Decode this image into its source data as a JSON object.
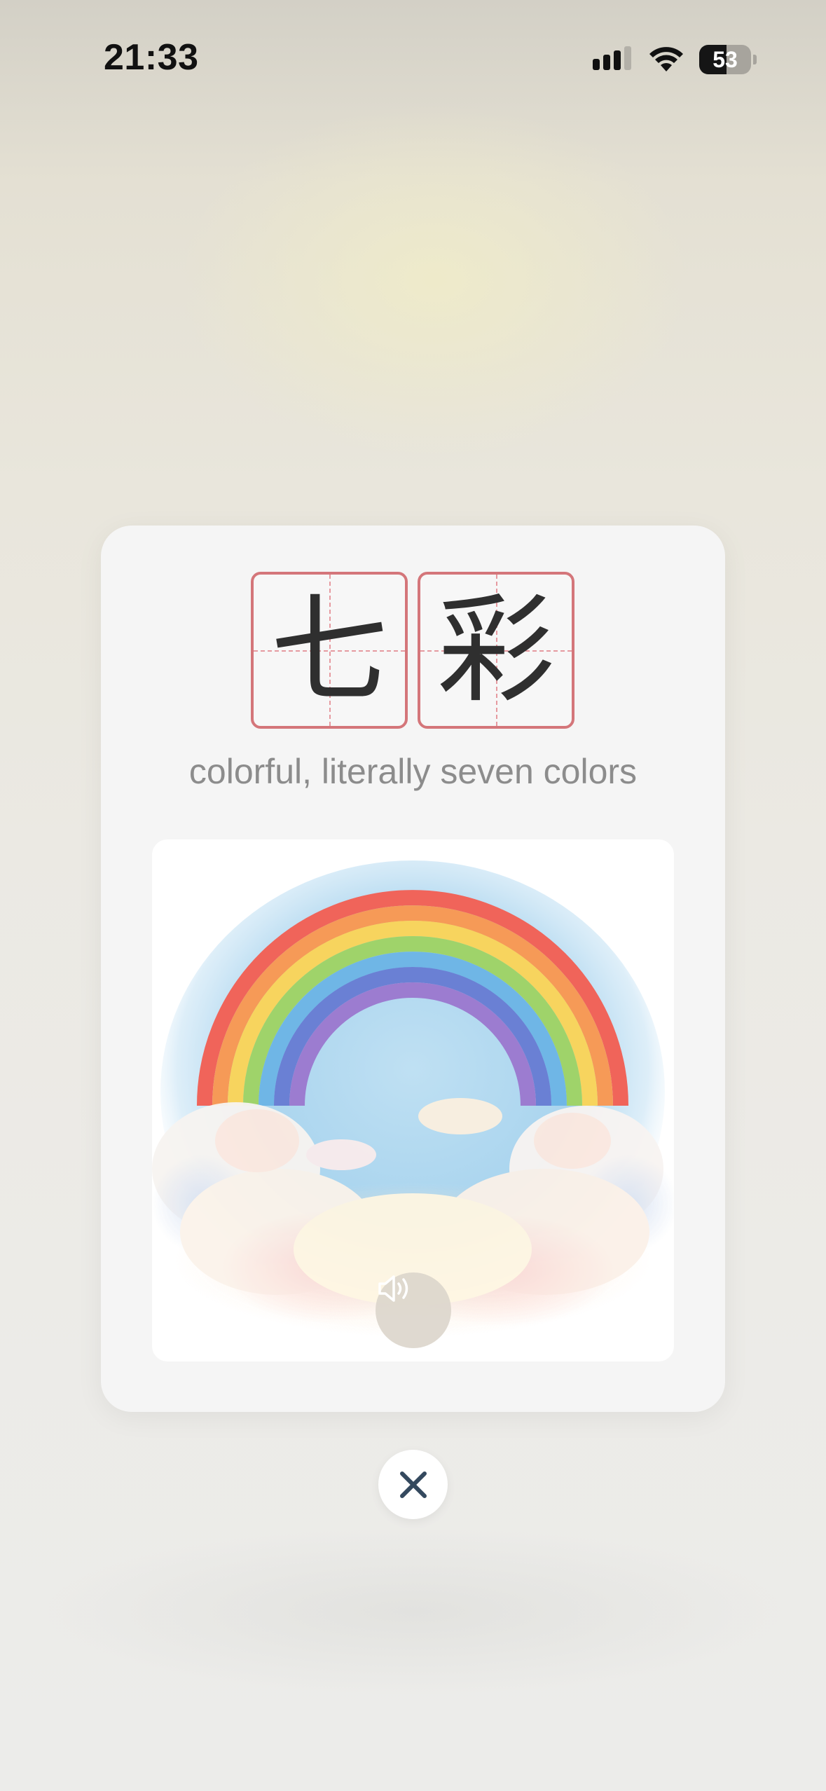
{
  "status_bar": {
    "time": "21:33",
    "battery_percent": "53",
    "battery_level": 0.53,
    "icons": [
      "cellular-signal-icon",
      "wifi-icon",
      "battery-icon"
    ]
  },
  "flashcard": {
    "characters": [
      "七",
      "彩"
    ],
    "meaning": "colorful, literally seven colors",
    "illustration": "rainbow-over-clouds",
    "audio_button_icon": "speaker-icon",
    "grid_color": "#d4767a"
  },
  "close_button": {
    "icon": "close-icon"
  },
  "colors": {
    "character": "#2f2f2f",
    "meaning_text": "#8c8c8c",
    "close_icon": "#34495e",
    "card_background": "#f5f5f5"
  }
}
